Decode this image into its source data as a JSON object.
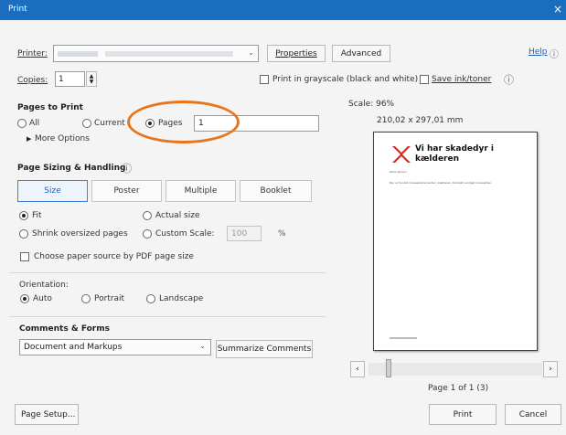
{
  "window": {
    "title": "Print",
    "close": "×"
  },
  "header": {
    "printer_label": "Printer:",
    "properties_label": "Properties",
    "advanced_label": "Advanced",
    "help_label": "Help",
    "copies_label": "Copies:",
    "copies_value": "1",
    "grayscale_label": "Print in grayscale (black and white)",
    "save_ink_label": "Save ink/toner",
    "info_glyph": "ⓘ"
  },
  "pages_to_print": {
    "heading": "Pages to Print",
    "all_label": "All",
    "current_label": "Current",
    "pages_label": "Pages",
    "pages_value": "1",
    "more_options_label": "More Options"
  },
  "sizing": {
    "heading": "Page Sizing & Handling",
    "tabs": [
      {
        "label": "Size",
        "selected": true
      },
      {
        "label": "Poster",
        "selected": false
      },
      {
        "label": "Multiple",
        "selected": false
      },
      {
        "label": "Booklet",
        "selected": false
      }
    ],
    "fit_label": "Fit",
    "actual_size_label": "Actual size",
    "shrink_label": "Shrink oversized pages",
    "custom_scale_label": "Custom Scale:",
    "custom_scale_value": "100",
    "percent": "%",
    "paper_source_label": "Choose paper source by PDF page size"
  },
  "orientation": {
    "label": "Orientation:",
    "auto_label": "Auto",
    "portrait_label": "Portrait",
    "landscape_label": "Landscape"
  },
  "comments": {
    "heading": "Comments & Forms",
    "selected_option": "Document and Markups",
    "summarize_label": "Summarize Comments"
  },
  "preview": {
    "scale_text": "Scale: 96%",
    "dimensions": "210,02 x 297,01 mm",
    "doc_title_line1": "Vi har skadedyr i",
    "doc_title_line2": "kælderen",
    "doc_author": "Karin Jensen",
    "doc_body": "Der er fundet museekskrementer i kælderen. Kontakt venligst viceværten.",
    "page_counter": "Page 1 of 1 (3)"
  },
  "footer": {
    "page_setup_label": "Page Setup...",
    "print_label": "Print",
    "cancel_label": "Cancel"
  },
  "colors": {
    "titlebar": "#1a6dbf",
    "accent": "#3c82d8",
    "highlight_ring": "#e8741c",
    "doc_icon": "#d4281c"
  }
}
